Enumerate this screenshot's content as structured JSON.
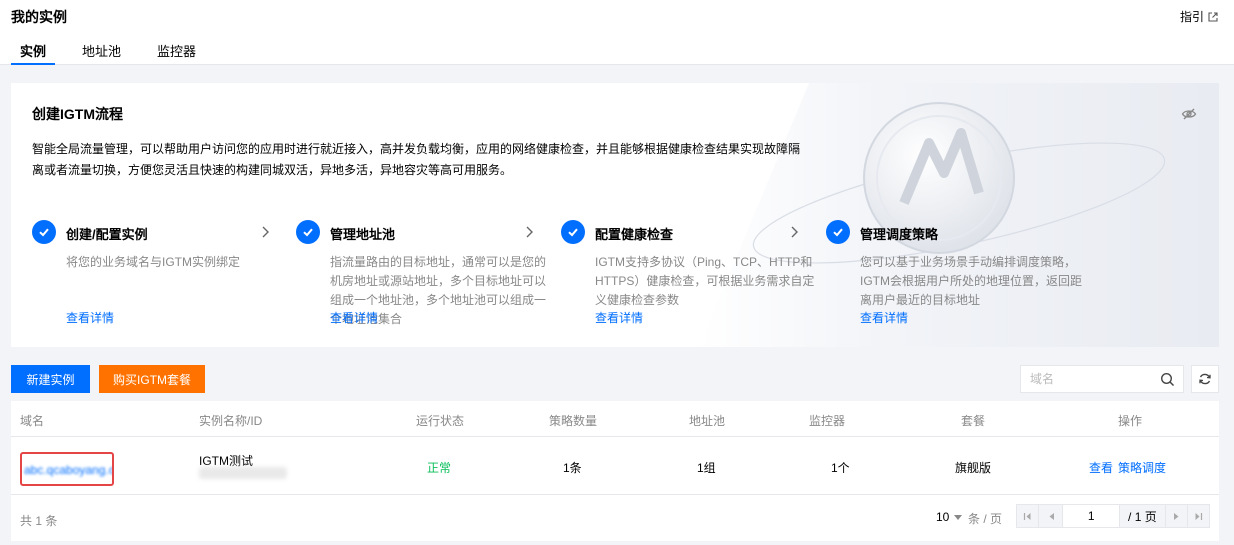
{
  "header": {
    "title": "我的实例",
    "guide": "指引",
    "tabs": [
      {
        "label": "实例",
        "active": true
      },
      {
        "label": "地址池",
        "active": false
      },
      {
        "label": "监控器",
        "active": false
      }
    ]
  },
  "guide_card": {
    "title": "创建IGTM流程",
    "description": "智能全局流量管理，可以帮助用户访问您的应用时进行就近接入，高并发负载均衡，应用的网络健康检查，并且能够根据健康检查结果实现故障隔离或者流量切换，方便您灵活且快速的构建同城双活，异地多活，异地容灾等高可用服务。",
    "steps": [
      {
        "title": "创建/配置实例",
        "desc": "将您的业务域名与IGTM实例绑定",
        "link": "查看详情"
      },
      {
        "title": "管理地址池",
        "desc": "指流量路由的目标地址，通常可以是您的机房地址或源站地址，多个目标地址可以组成一个地址池，多个地址池可以组成一个地址池集合",
        "link": "查看详情"
      },
      {
        "title": "配置健康检查",
        "desc": "IGTM支持多协议（Ping、TCP、HTTP和HTTPS）健康检查，可根据业务需求自定义健康检查参数",
        "link": "查看详情"
      },
      {
        "title": "管理调度策略",
        "desc": "您可以基于业务场景手动编排调度策略，IGTM会根据用户所处的地理位置，返回距离用户最近的目标地址",
        "link": "查看详情"
      }
    ]
  },
  "toolbar": {
    "create_label": "新建实例",
    "buy_label": "购买IGTM套餐",
    "search_placeholder": "域名"
  },
  "table": {
    "columns": [
      "域名",
      "实例名称/ID",
      "运行状态",
      "策略数量",
      "地址池",
      "监控器",
      "套餐",
      "操作"
    ],
    "rows": [
      {
        "domain": "abc.qcaboyang.cn",
        "name": "IGTM测试",
        "status": "正常",
        "policy_count": "1条",
        "pool": "1组",
        "monitor": "1个",
        "plan": "旗舰版",
        "actions": [
          "查看",
          "策略调度"
        ]
      }
    ]
  },
  "footer": {
    "total": "共 1 条",
    "page_size": "10",
    "per_page": "条 / 页",
    "current_page": "1",
    "total_pages": "/ 1 页"
  },
  "colors": {
    "primary": "#006eff",
    "orange": "#ff7200",
    "success": "#0abf5b",
    "highlight": "#e54545"
  }
}
